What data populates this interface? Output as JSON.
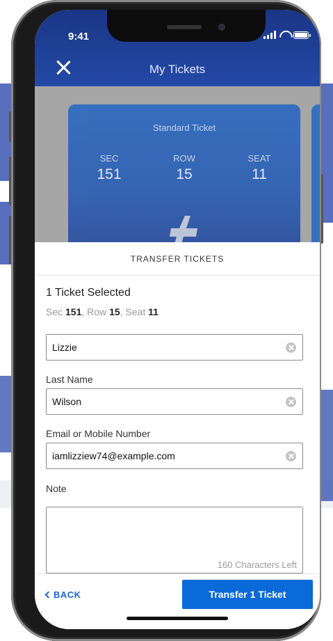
{
  "status_bar": {
    "time": "9:41"
  },
  "header": {
    "title": "My Tickets"
  },
  "ticket": {
    "type": "Standard Ticket",
    "sec_label": "SEC",
    "sec_value": "151",
    "row_label": "ROW",
    "row_value": "15",
    "seat_label": "SEAT",
    "seat_value": "11"
  },
  "transfer": {
    "title": "TRANSFER TICKETS",
    "selected_count": "1 Ticket Selected",
    "detail": {
      "sec_prefix": "Sec ",
      "sec": "151",
      "row_prefix": ", Row ",
      "row": "15",
      "seat_prefix": ", Seat ",
      "seat": "11"
    },
    "first_name_value": "Lizzie",
    "last_name_label": "Last Name",
    "last_name_value": "Wilson",
    "email_label": "Email or Mobile Number",
    "email_value": "iamlizziew74@example.com",
    "note_label": "Note",
    "note_value": "",
    "chars_left": "160 Characters Left"
  },
  "footer": {
    "back_label": "BACK",
    "transfer_label": "Transfer 1 Ticket"
  },
  "colors": {
    "accent": "#0a6ad8",
    "header": "#1a3585",
    "card": "#2d6bc0"
  }
}
